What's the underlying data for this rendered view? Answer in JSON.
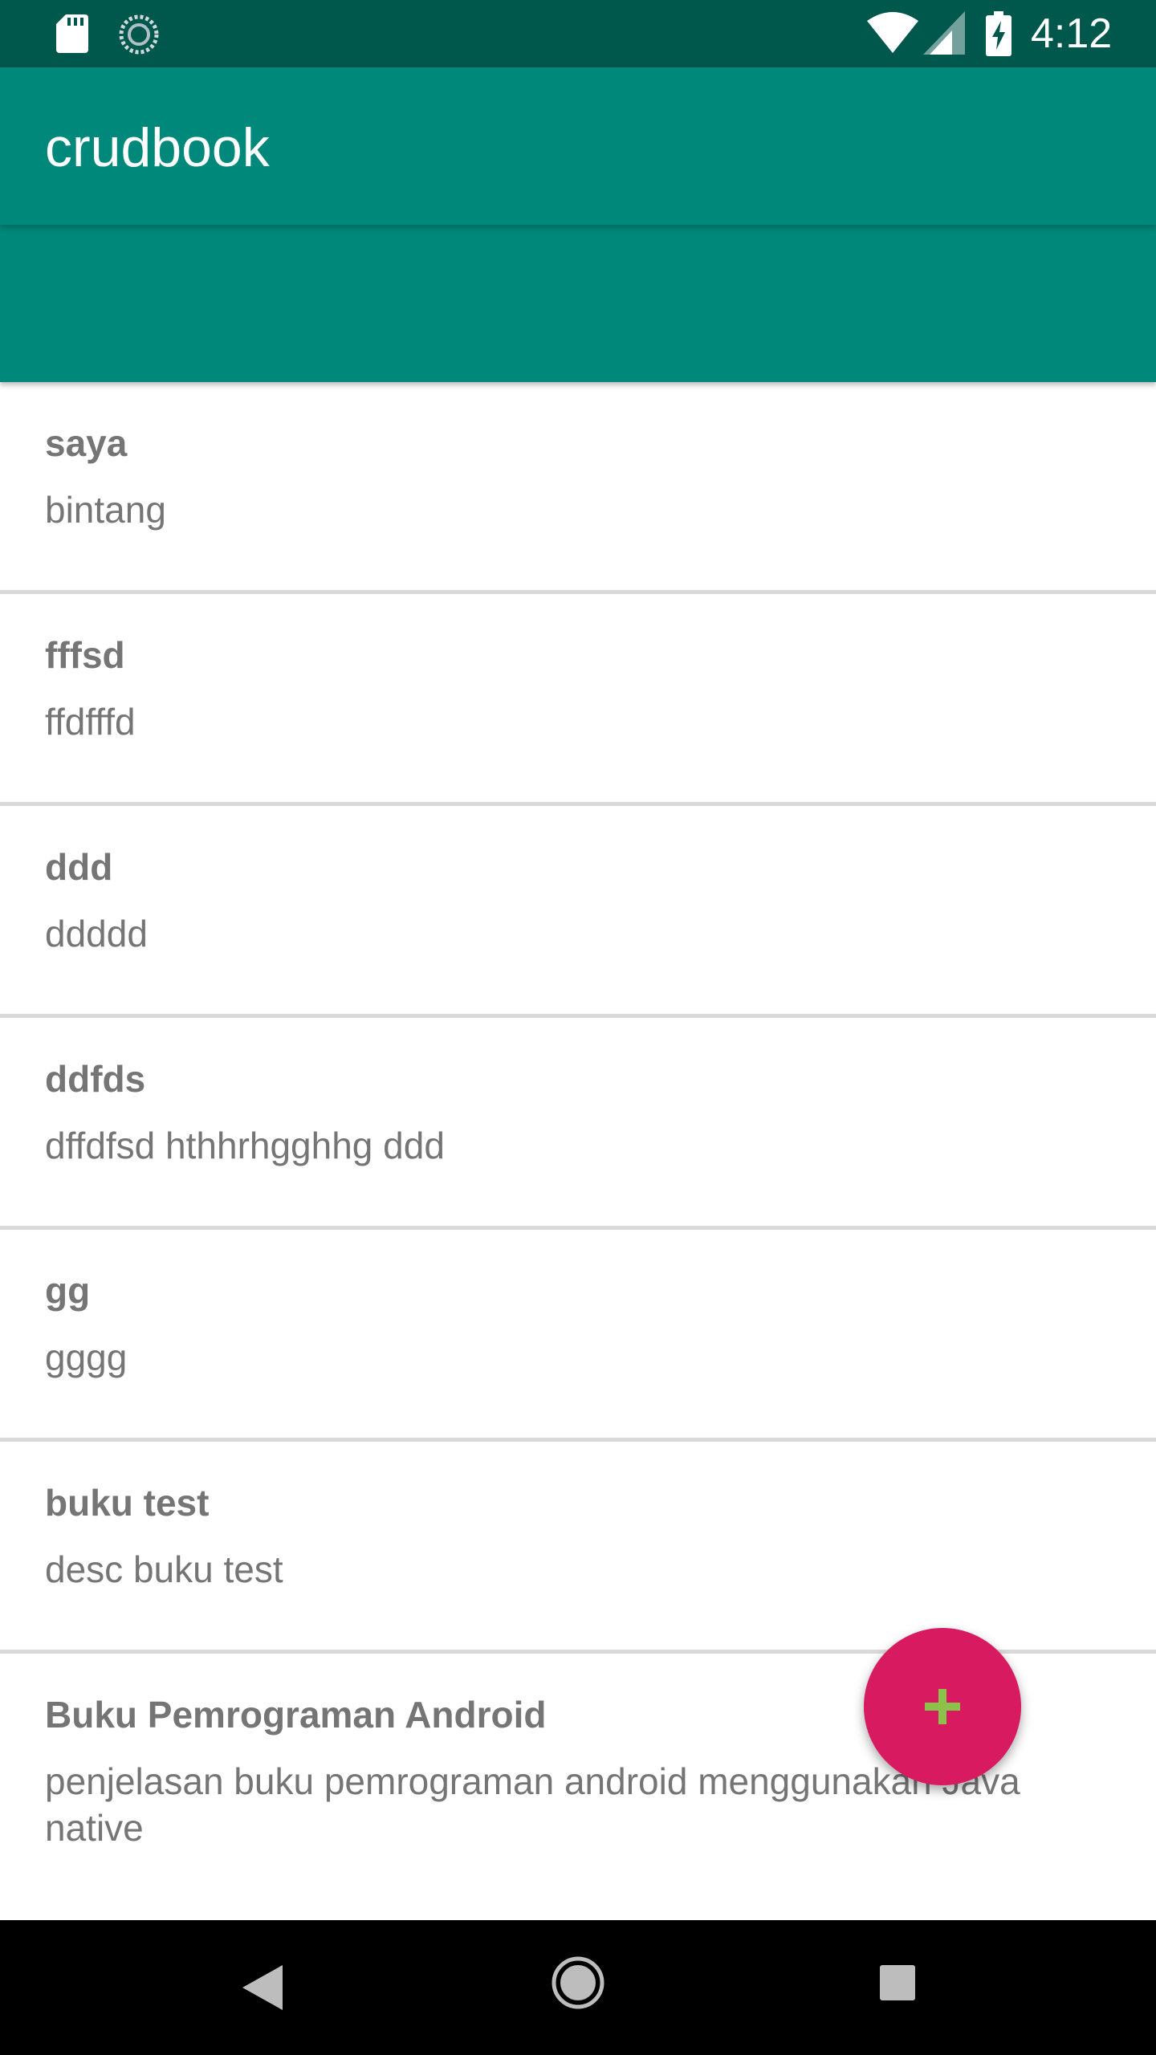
{
  "status_bar": {
    "time": "4:12",
    "icons": [
      "sd-card-icon",
      "sync-icon",
      "wifi-icon",
      "cell-signal-icon",
      "battery-charging-icon"
    ]
  },
  "app_bar": {
    "title": "crudbook"
  },
  "books": [
    {
      "title": "saya",
      "description": "bintang"
    },
    {
      "title": "fffsd",
      "description": "ffdfffd"
    },
    {
      "title": "ddd",
      "description": "ddddd"
    },
    {
      "title": "ddfds",
      "description": "dffdfsd hthhrhgghhg ddd"
    },
    {
      "title": "gg",
      "description": "gggg"
    },
    {
      "title": "buku test",
      "description": "desc buku test"
    },
    {
      "title": "Buku Pemrograman Android",
      "description": "penjelasan buku pemrograman android menggunakan Java native"
    }
  ],
  "fab": {
    "icon": "add-icon"
  },
  "nav_bar": {
    "icons": [
      "back-icon",
      "home-icon",
      "recents-icon"
    ]
  },
  "colors": {
    "status_bar": "#00574b",
    "primary": "#00897b",
    "accent": "#d81b60",
    "fab_icon": "#8bc34a",
    "text_secondary": "#757575",
    "divider": "#d9d9d9"
  }
}
